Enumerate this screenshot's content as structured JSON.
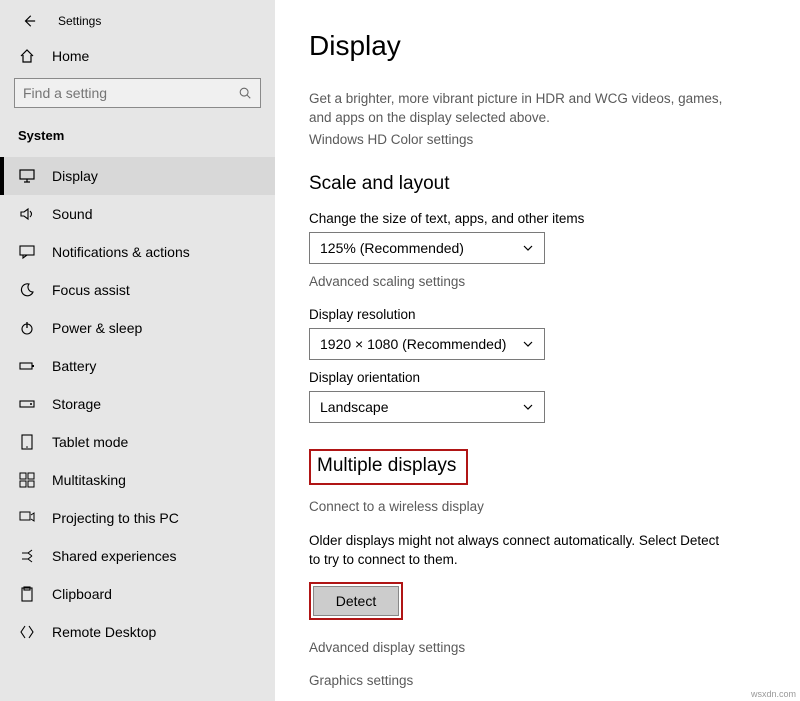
{
  "header": {
    "title": "Settings"
  },
  "home": {
    "label": "Home"
  },
  "search": {
    "placeholder": "Find a setting"
  },
  "category": "System",
  "sidebar": {
    "items": [
      {
        "label": "Display",
        "icon": "monitor-icon",
        "selected": true
      },
      {
        "label": "Sound",
        "icon": "sound-icon"
      },
      {
        "label": "Notifications & actions",
        "icon": "chat-icon"
      },
      {
        "label": "Focus assist",
        "icon": "moon-icon"
      },
      {
        "label": "Power & sleep",
        "icon": "power-icon"
      },
      {
        "label": "Battery",
        "icon": "battery-icon"
      },
      {
        "label": "Storage",
        "icon": "storage-icon"
      },
      {
        "label": "Tablet mode",
        "icon": "tablet-icon"
      },
      {
        "label": "Multitasking",
        "icon": "multitask-icon"
      },
      {
        "label": "Projecting to this PC",
        "icon": "project-icon"
      },
      {
        "label": "Shared experiences",
        "icon": "share-icon"
      },
      {
        "label": "Clipboard",
        "icon": "clipboard-icon"
      },
      {
        "label": "Remote Desktop",
        "icon": "remote-icon"
      }
    ]
  },
  "main": {
    "title": "Display",
    "hdr_desc1": "Get a brighter, more vibrant picture in HDR and WCG videos, games,",
    "hdr_desc2": "and apps on the display selected above.",
    "hdr_link": "Windows HD Color settings",
    "scale_heading": "Scale and layout",
    "scale_label": "Change the size of text, apps, and other items",
    "scale_value": "125% (Recommended)",
    "scale_link": "Advanced scaling settings",
    "res_label": "Display resolution",
    "res_value": "1920 × 1080 (Recommended)",
    "orient_label": "Display orientation",
    "orient_value": "Landscape",
    "multi_heading": "Multiple displays",
    "wireless_link": "Connect to a wireless display",
    "detect_note": "Older displays might not always connect automatically. Select Detect to try to connect to them.",
    "detect_btn": "Detect",
    "adv_link": "Advanced display settings",
    "gfx_link": "Graphics settings"
  },
  "watermark": "wsxdn.com"
}
